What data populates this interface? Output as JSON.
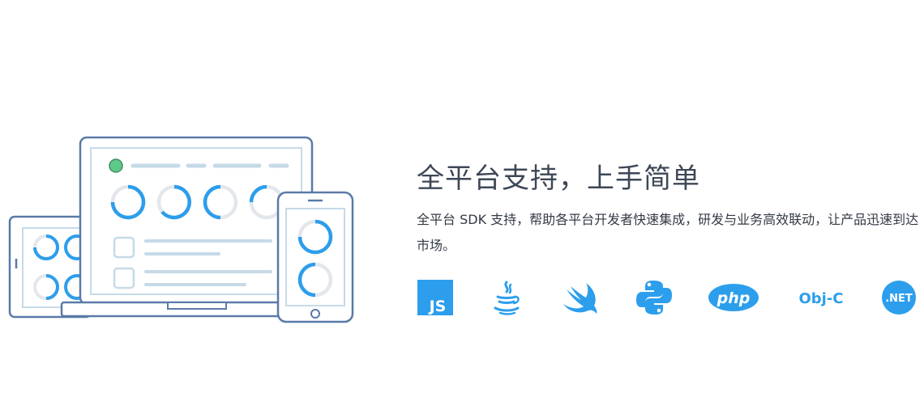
{
  "hero": {
    "title": "全平台支持，上手简单",
    "description": "全平台 SDK 支持，帮助各平台开发者快速集成，研发与业务高效联动，让产品迅速到达市场。"
  },
  "platforms": [
    {
      "name": "JavaScript",
      "icon": "js-icon",
      "text": "JS"
    },
    {
      "name": "Java",
      "icon": "java-icon"
    },
    {
      "name": "Swift",
      "icon": "swift-icon"
    },
    {
      "name": "Python",
      "icon": "python-icon"
    },
    {
      "name": "PHP",
      "icon": "php-icon",
      "text": "php"
    },
    {
      "name": "Objective-C",
      "icon": "objc-icon",
      "text": "Obj-C"
    },
    {
      "name": ".NET",
      "icon": "dotnet-icon",
      "text": ".NET"
    }
  ],
  "colors": {
    "accent": "#2c9eec",
    "outline": "#5a7aa8",
    "muted_bar": "#c6dae8",
    "status_dot": "#5fc98a",
    "heading": "#3d4756",
    "body_text": "#333a44"
  }
}
